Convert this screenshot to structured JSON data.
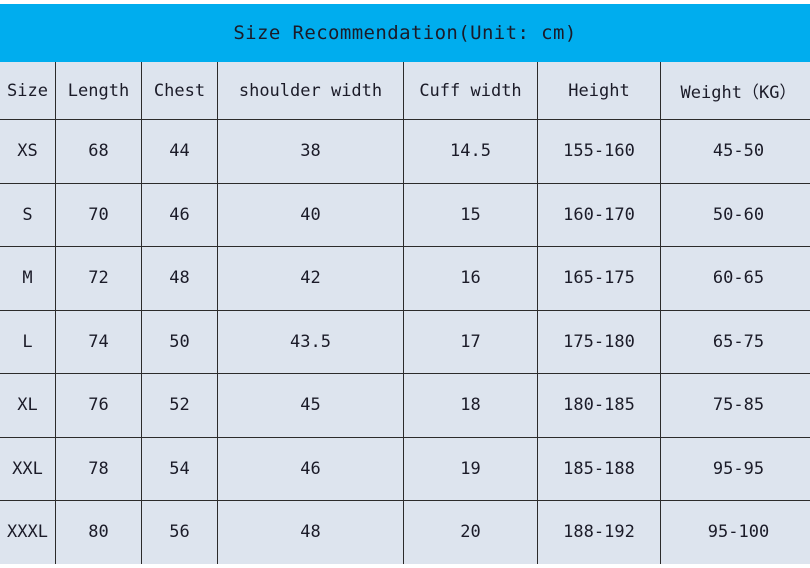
{
  "title": "Size Recommendation(Unit: cm)",
  "colors": {
    "title_bar_background": "#00ADEE",
    "cell_background": "#dde4ee",
    "border": "#2b2b2b",
    "text": "#1b1b28",
    "page_background": "#ffffff"
  },
  "table": {
    "columns": [
      "Size",
      "Length",
      "Chest",
      "shoulder width",
      "Cuff width",
      "Height",
      "Weight（KG）"
    ],
    "rows": [
      {
        "size": "XS",
        "length": "68",
        "chest": "44",
        "shoulder_width": "38",
        "cuff_width": "14.5",
        "height": "155-160",
        "weight": "45-50"
      },
      {
        "size": "S",
        "length": "70",
        "chest": "46",
        "shoulder_width": "40",
        "cuff_width": "15",
        "height": "160-170",
        "weight": "50-60"
      },
      {
        "size": "M",
        "length": "72",
        "chest": "48",
        "shoulder_width": "42",
        "cuff_width": "16",
        "height": "165-175",
        "weight": "60-65"
      },
      {
        "size": "L",
        "length": "74",
        "chest": "50",
        "shoulder_width": "43.5",
        "cuff_width": "17",
        "height": "175-180",
        "weight": "65-75"
      },
      {
        "size": "XL",
        "length": "76",
        "chest": "52",
        "shoulder_width": "45",
        "cuff_width": "18",
        "height": "180-185",
        "weight": "75-85"
      },
      {
        "size": "XXL",
        "length": "78",
        "chest": "54",
        "shoulder_width": "46",
        "cuff_width": "19",
        "height": "185-188",
        "weight": "95-95"
      },
      {
        "size": "XXXL",
        "length": "80",
        "chest": "56",
        "shoulder_width": "48",
        "cuff_width": "20",
        "height": "188-192",
        "weight": "95-100"
      }
    ]
  }
}
